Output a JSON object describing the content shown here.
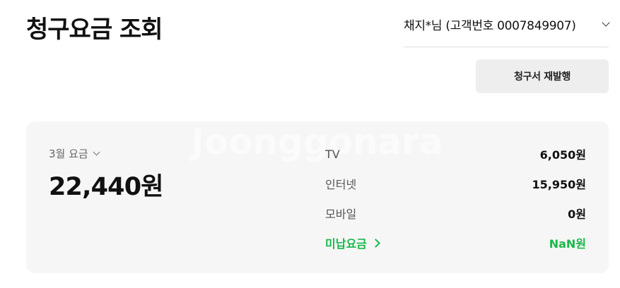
{
  "header": {
    "title": "청구요금 조회",
    "customer_label": "채지*님 (고객번호 0007849907)"
  },
  "actions": {
    "reissue_label": "청구서 재발행"
  },
  "bill": {
    "month_label": "3월 요금",
    "total": "22,440원",
    "watermark": "Joonggonara",
    "items": [
      {
        "label": "TV",
        "value": "6,050원"
      },
      {
        "label": "인터넷",
        "value": "15,950원"
      },
      {
        "label": "모바일",
        "value": "0원"
      },
      {
        "label": "미납요금",
        "value": "NaN원"
      }
    ]
  },
  "colors": {
    "accent_green": "#19b84a",
    "card_bg": "#f6f6f6",
    "button_bg": "#eeeeee"
  }
}
